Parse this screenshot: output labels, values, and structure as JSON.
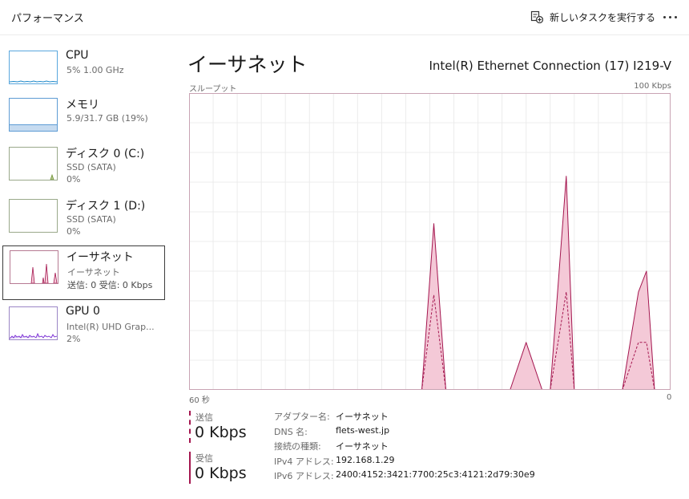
{
  "header": {
    "title": "パフォーマンス",
    "new_task_label": "新しいタスクを実行する",
    "more_label": "..."
  },
  "sidebar": {
    "items": [
      {
        "name": "CPU",
        "sub1": "5%  1.00 GHz",
        "sub2": "",
        "icon": "cpu-thumb"
      },
      {
        "name": "メモリ",
        "sub1": "5.9/31.7 GB (19%)",
        "sub2": "",
        "icon": "memory-thumb"
      },
      {
        "name": "ディスク 0 (C:)",
        "sub1": "SSD (SATA)",
        "sub2": "0%",
        "icon": "disk-thumb"
      },
      {
        "name": "ディスク 1 (D:)",
        "sub1": "SSD (SATA)",
        "sub2": "0%",
        "icon": "disk-thumb"
      },
      {
        "name": "イーサネット",
        "sub1": "イーサネット",
        "sub2": "送信: 0 受信: 0 Kbps",
        "icon": "ethernet-thumb",
        "selected": true
      },
      {
        "name": "GPU 0",
        "sub1": "Intel(R) UHD Grap...",
        "sub2": "2%",
        "icon": "gpu-thumb"
      }
    ]
  },
  "main": {
    "title": "イーサネット",
    "adapter": "Intel(R) Ethernet Connection (17) I219-V",
    "chart_label": "スループット",
    "chart_max": "100 Kbps",
    "time_left": "60 秒",
    "time_right": "0"
  },
  "stats": {
    "send_label": "送信",
    "send_value": "0 Kbps",
    "recv_label": "受信",
    "recv_value": "0 Kbps"
  },
  "info": [
    {
      "key": "アダプター名:",
      "value": "イーサネット"
    },
    {
      "key": "DNS 名:",
      "value": "flets-west.jp"
    },
    {
      "key": "接続の種類:",
      "value": "イーサネット"
    },
    {
      "key": "IPv4 アドレス:",
      "value": "192.168.1.29"
    },
    {
      "key": "IPv6 アドレス:",
      "value": "2400:4152:3421:7700:25c3:4121:2d79:30e9"
    }
  ],
  "colors": {
    "ethernet": "#a4164f",
    "ethernet_fill": "#f4c9d7",
    "cpu": "#1e88c9",
    "memory": "#5e9cd4",
    "disk": "#6d9132",
    "gpu": "#7b2fd6",
    "grid": "#ececec"
  },
  "chart_data": {
    "type": "area",
    "title": "スループット",
    "ylim": [
      0,
      100
    ],
    "xlim": [
      60,
      0
    ],
    "x_unit": "seconds ago",
    "y_unit": "Kbps",
    "series": [
      {
        "name": "受信",
        "x": [
          60,
          31,
          29.5,
          28,
          20,
          18,
          16,
          15,
          13,
          12,
          6,
          4,
          3,
          2
        ],
        "values": [
          0,
          0,
          56,
          0,
          0,
          16,
          0,
          0,
          72,
          0,
          0,
          33,
          40,
          0
        ]
      },
      {
        "name": "送信",
        "x": [
          60,
          31,
          29.5,
          28,
          16,
          15,
          13,
          12,
          6,
          4,
          3,
          2
        ],
        "values": [
          0,
          0,
          32,
          0,
          0,
          0,
          33,
          0,
          0,
          16,
          16,
          0
        ]
      }
    ]
  }
}
